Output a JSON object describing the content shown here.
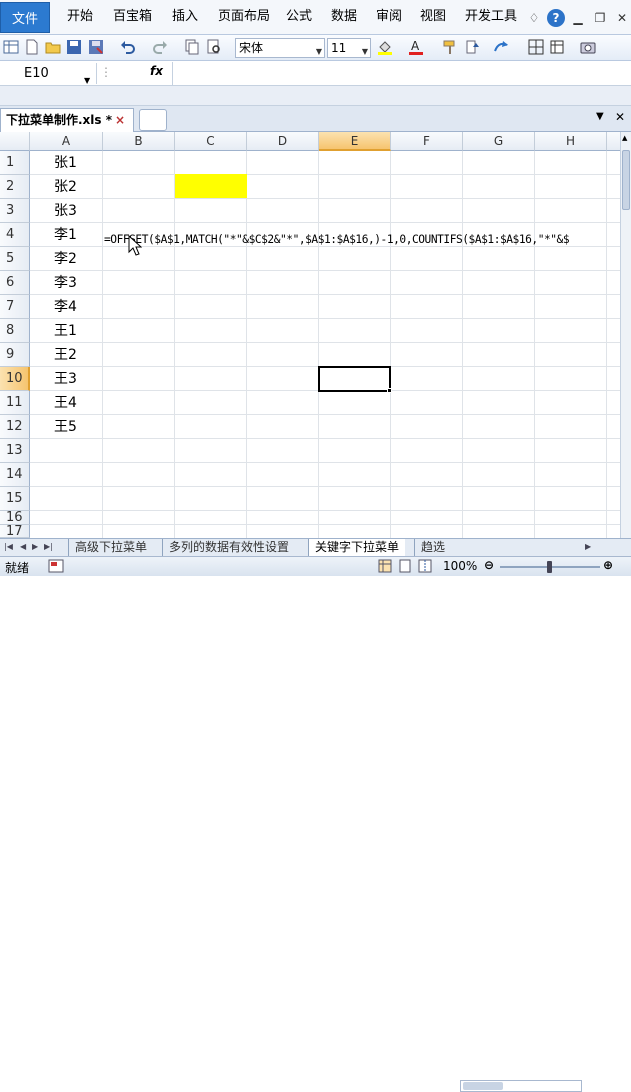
{
  "menubar": {
    "file": "文件",
    "items": [
      "开始",
      "百宝箱",
      "插入",
      "页面布局",
      "公式",
      "数据",
      "审阅",
      "视图",
      "开发工具"
    ]
  },
  "toolbar": {
    "font_name": "宋体",
    "font_size": "11"
  },
  "formula_bar": {
    "name_box": "E10",
    "fx_label": "fx"
  },
  "doc_tab": {
    "title": "下拉菜单制作.xls *",
    "close": "×"
  },
  "grid": {
    "columns": [
      "A",
      "B",
      "C",
      "D",
      "E",
      "F",
      "G",
      "H"
    ],
    "rows": [
      "1",
      "2",
      "3",
      "4",
      "5",
      "6",
      "7",
      "8",
      "9",
      "10",
      "11",
      "12",
      "13",
      "14",
      "15",
      "16",
      "17"
    ],
    "col_a_values": [
      "张1",
      "张2",
      "张3",
      "李1",
      "李2",
      "李3",
      "李4",
      "王1",
      "王2",
      "王3",
      "王4",
      "王5"
    ],
    "b4_formula": "=OFFSET($A$1,MATCH(\"*\"&$C$2&\"*\",$A$1:$A$16,)-1,0,COUNTIFS($A$1:$A$16,\"*\"&$",
    "active_cell": "E10",
    "highlight_color": "#ffff00"
  },
  "sheet_tabs": {
    "tabs": [
      "高级下拉菜单",
      "多列的数据有效性设置",
      "关键字下拉菜单",
      "趋选"
    ],
    "active_index": 2
  },
  "status": {
    "text": "就绪",
    "zoom": "100%"
  },
  "colors": {
    "file_menu_bg": "#2c7ad0",
    "selection_header": "#f6c46f"
  }
}
